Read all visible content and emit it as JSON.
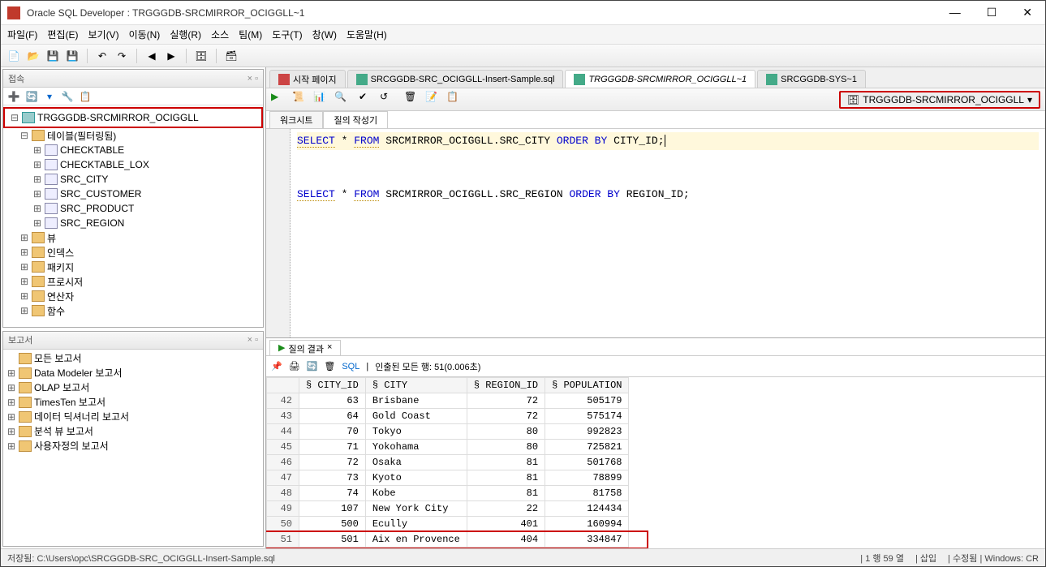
{
  "title": "Oracle SQL Developer : TRGGGDB-SRCMIRROR_OCIGGLL~1",
  "menus": [
    "파일(F)",
    "편집(E)",
    "보기(V)",
    "이동(N)",
    "실행(R)",
    "소스",
    "팀(M)",
    "도구(T)",
    "창(W)",
    "도움말(H)"
  ],
  "left": {
    "conn_title": "접속",
    "connection": "TRGGGDB-SRCMIRROR_OCIGGLL",
    "tables_label": "테이블(필터링됨)",
    "tables": [
      "CHECKTABLE",
      "CHECKTABLE_LOX",
      "SRC_CITY",
      "SRC_CUSTOMER",
      "SRC_PRODUCT",
      "SRC_REGION"
    ],
    "folders": [
      "뷰",
      "인덱스",
      "패키지",
      "프로시저",
      "연산자",
      "함수"
    ],
    "rpt_title": "보고서",
    "rpt_items": [
      "모든 보고서",
      "Data Modeler 보고서",
      "OLAP 보고서",
      "TimesTen 보고서",
      "데이터 딕셔너리 보고서",
      "분석 뷰 보고서",
      "사용자정의 보고서"
    ]
  },
  "tabs": [
    {
      "label": "시작 페이지",
      "active": false,
      "icon": "red"
    },
    {
      "label": "SRCGGDB-SRC_OCIGGLL-Insert-Sample.sql",
      "active": false,
      "icon": "sql"
    },
    {
      "label": "TRGGGDB-SRCMIRROR_OCIGGLL~1",
      "active": true,
      "icon": "sql"
    },
    {
      "label": "SRCGGDB-SYS~1",
      "active": false,
      "icon": "sql"
    }
  ],
  "conn_dd": "TRGGGDB-SRCMIRROR_OCIGGLL",
  "subtabs": [
    "워크시트",
    "질의 작성기"
  ],
  "sql_line1_kw1": "SELECT",
  "sql_line1_mid": " * ",
  "sql_line1_kw2": "FROM",
  "sql_line1_id": " SRCMIRROR_OCIGGLL.SRC_CITY ",
  "sql_line1_kw3": "ORDER BY",
  "sql_line1_col": " CITY_ID",
  "sql_line1_end": ";",
  "sql_line2_kw1": "SELECT",
  "sql_line2_mid": " * ",
  "sql_line2_kw2": "FROM",
  "sql_line2_id": " SRCMIRROR_OCIGGLL.SRC_REGION ",
  "sql_line2_kw3": "ORDER BY",
  "sql_line2_col": " REGION_ID;",
  "result": {
    "tab_label": "질의 결과",
    "sql_link": "SQL",
    "fetched": "인출된 모든 행: 51(0.006초)",
    "columns": [
      "CITY_ID",
      "CITY",
      "REGION_ID",
      "POPULATION"
    ],
    "rows": [
      {
        "n": 42,
        "id": 63,
        "city": "Brisbane",
        "region": 72,
        "pop": 505179
      },
      {
        "n": 43,
        "id": 64,
        "city": "Gold Coast",
        "region": 72,
        "pop": 575174
      },
      {
        "n": 44,
        "id": 70,
        "city": "Tokyo",
        "region": 80,
        "pop": 992823
      },
      {
        "n": 45,
        "id": 71,
        "city": "Yokohama",
        "region": 80,
        "pop": 725821
      },
      {
        "n": 46,
        "id": 72,
        "city": "Osaka",
        "region": 81,
        "pop": 501768
      },
      {
        "n": 47,
        "id": 73,
        "city": "Kyoto",
        "region": 81,
        "pop": 78899
      },
      {
        "n": 48,
        "id": 74,
        "city": "Kobe",
        "region": 81,
        "pop": 81758
      },
      {
        "n": 49,
        "id": 107,
        "city": "New York City",
        "region": 22,
        "pop": 124434
      },
      {
        "n": 50,
        "id": 500,
        "city": "Ecully",
        "region": 401,
        "pop": 160994
      },
      {
        "n": 51,
        "id": 501,
        "city": "Aix en Provence",
        "region": 404,
        "pop": 334847
      }
    ]
  },
  "status": {
    "left": "저장됨: C:\\Users\\opc\\SRCGGDB-SRC_OCIGGLL-Insert-Sample.sql",
    "pos": "| 1 행 59 열",
    "ins": "| 삽입",
    "mod": "| 수정됨 | Windows: CR"
  }
}
